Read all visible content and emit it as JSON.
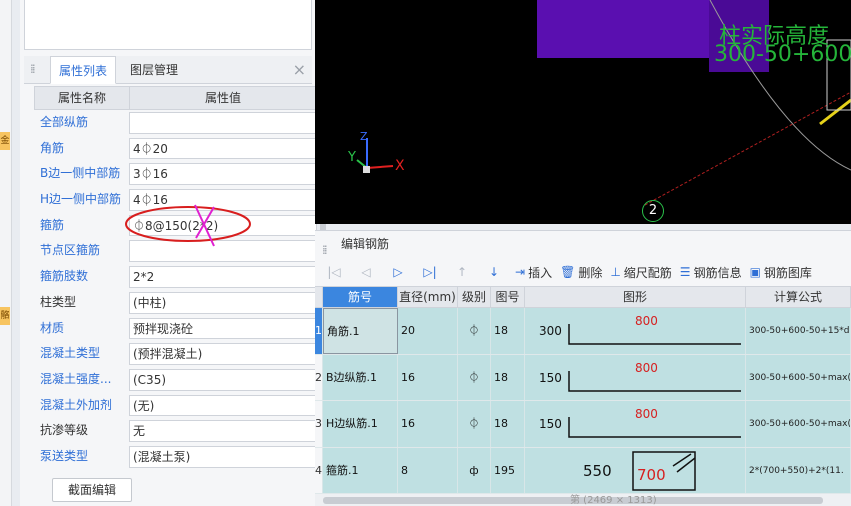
{
  "left_strip": {
    "tag1": "金",
    "tag2": "骼"
  },
  "properties_panel": {
    "tabs": {
      "active": "属性列表",
      "inactive": "图层管理"
    },
    "close": "×",
    "headers": {
      "name": "属性名称",
      "value": "属性值"
    },
    "rows": [
      {
        "name": "全部纵筋",
        "value": "",
        "blue": true
      },
      {
        "name": "角筋",
        "value": "4⏀20",
        "blue": true
      },
      {
        "name": "B边一侧中部筋",
        "value": "3⏀16",
        "blue": true
      },
      {
        "name": "H边一侧中部筋",
        "value": "4⏀16",
        "blue": true
      },
      {
        "name": "箍筋",
        "value": "⏀8@150(2*2)",
        "blue": true
      },
      {
        "name": "节点区箍筋",
        "value": "",
        "blue": true
      },
      {
        "name": "箍筋肢数",
        "value": "2*2",
        "blue": true
      },
      {
        "name": "柱类型",
        "value": "(中柱)",
        "blue": false
      },
      {
        "name": "材质",
        "value": "预拌现浇砼",
        "blue": true
      },
      {
        "name": "混凝土类型",
        "value": "(预拌混凝土)",
        "blue": true
      },
      {
        "name": "混凝土强度...",
        "value": "(C35)",
        "blue": true
      },
      {
        "name": "混凝土外加剂",
        "value": "(无)",
        "blue": true
      },
      {
        "name": "抗渗等级",
        "value": "无",
        "blue": false
      },
      {
        "name": "泵送类型",
        "value": "(混凝土泵)",
        "blue": true
      }
    ],
    "section_edit_button": "截面编辑"
  },
  "viewport": {
    "overlay_line1": "柱实际高度",
    "overlay_line2": "300-50+600",
    "axis_x": "X",
    "axis_y": "Y",
    "axis_z": "Z",
    "marker": "2",
    "colors": {
      "column": "#5a0fb0",
      "text": "#25b53a",
      "highlight": "#e6d21a"
    }
  },
  "rebar_editor": {
    "title": "编辑钢筋",
    "toolbar": {
      "nav_first": "|◁",
      "nav_prev": "◁",
      "nav_next": "▷",
      "nav_last": "▷|",
      "move_up": "↑",
      "move_down": "↓",
      "insert": "插入",
      "delete": "删除",
      "scale": "缩尺配筋",
      "info": "钢筋信息",
      "library": "钢筋图库"
    },
    "headers": [
      "筋号",
      "直径(mm)",
      "级别",
      "图号",
      "图形",
      "计算公式"
    ],
    "rows": [
      {
        "index": "1",
        "name": "角筋.1",
        "diameter": "20",
        "grade": "⏀",
        "figure": "18",
        "shape_left": "300",
        "shape_top": "800",
        "formula": "300-50+600-50+15*d"
      },
      {
        "index": "2",
        "name": "B边纵筋.1",
        "diameter": "16",
        "grade": "⏀",
        "figure": "18",
        "shape_left": "150",
        "shape_top": "800",
        "formula": "300-50+600-50+max("
      },
      {
        "index": "3",
        "name": "H边纵筋.1",
        "diameter": "16",
        "grade": "⏀",
        "figure": "18",
        "shape_left": "150",
        "shape_top": "800",
        "formula": "300-50+600-50+max("
      },
      {
        "index": "4",
        "name": "箍筋.1",
        "diameter": "8",
        "grade": "ф",
        "figure": "195",
        "shape_left": "550",
        "shape_top": "700",
        "formula": "2*(700+550)+2*(11."
      }
    ],
    "size_label": "第 (2469 × 1313)"
  }
}
